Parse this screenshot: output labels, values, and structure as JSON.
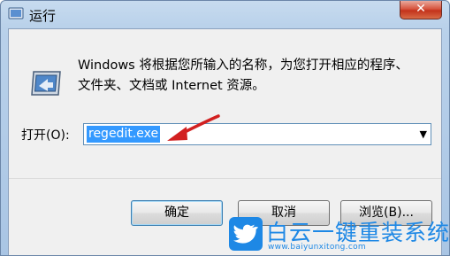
{
  "dialog": {
    "title": "运行",
    "close_glyph": "✕",
    "description_line1": "Windows 将根据您所输入的名称，为您打开相应的程序、",
    "description_line2": "文件夹、文档或 Internet 资源。",
    "open_label": "打开(O):",
    "open_value": "regedit.exe",
    "dropdown_glyph": "▼",
    "ok_label": "确定",
    "cancel_label": "取消",
    "browse_label": "浏览(B)..."
  },
  "watermark": {
    "title": "白云一键重装系统",
    "url": "www.baiyunxitong.com"
  },
  "colors": {
    "accent_blue": "#1e88e5",
    "selection": "#3399ff",
    "arrow_red": "#d22020",
    "close_red": "#c3331b"
  },
  "icons": [
    "run-app-icon",
    "run-dialog-icon",
    "red-arrow-annotation",
    "dropdown-arrow-icon",
    "twitter-bird-logo-icon"
  ]
}
